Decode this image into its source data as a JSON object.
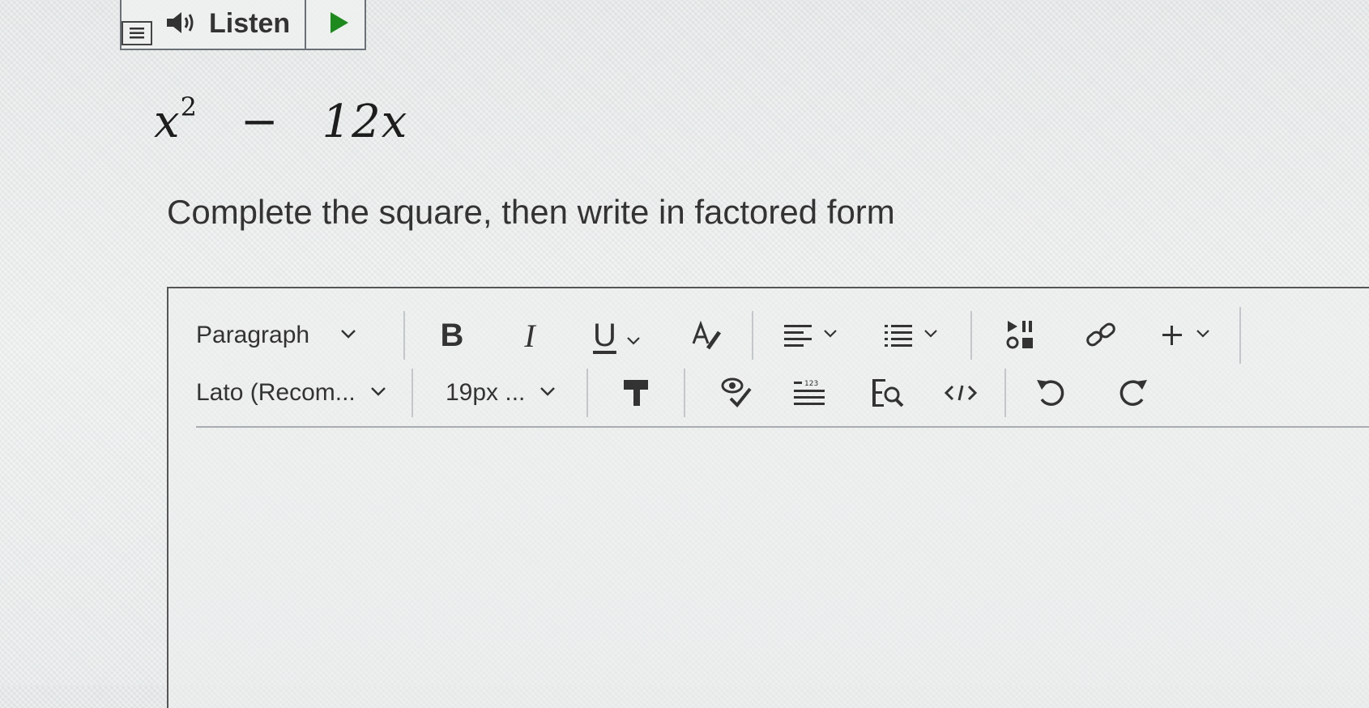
{
  "listen": {
    "menu_icon": "menu-icon",
    "speaker_icon": "speaker-icon",
    "label": "Listen",
    "play_icon": "play-icon"
  },
  "question": {
    "math_base": "x",
    "math_exponent": "2",
    "math_operator": "−",
    "math_term": "12x",
    "prompt": "Complete the square, then write in factored form"
  },
  "toolbar": {
    "block_format": "Paragraph",
    "bold_label": "B",
    "italic_label": "I",
    "underline_label": "U",
    "font_family": "Lato (Recom...",
    "font_size": "19px ...",
    "icons": [
      "chevron-down-icon",
      "text-color-icon",
      "align-icon",
      "list-icon",
      "media-icon",
      "link-icon",
      "plus-icon",
      "format-painter-icon",
      "accessibility-check-icon",
      "word-count-icon",
      "find-replace-icon",
      "code-icon",
      "undo-icon",
      "redo-icon"
    ],
    "accent_color": "#2d3b45"
  }
}
